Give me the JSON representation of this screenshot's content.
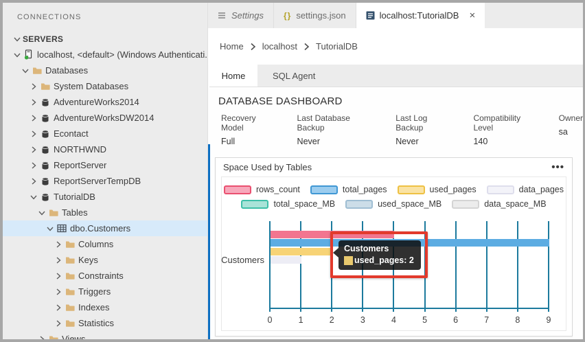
{
  "sidebar": {
    "title": "CONNECTIONS",
    "tree": [
      {
        "label": "SERVERS",
        "level": 0,
        "twistie": "down",
        "icon": null,
        "header": true
      },
      {
        "label": "localhost, <default> (Windows Authenticati...",
        "level": 0,
        "twistie": "down",
        "icon": "server"
      },
      {
        "label": "Databases",
        "level": 1,
        "twistie": "down",
        "icon": "folder"
      },
      {
        "label": "System Databases",
        "level": 2,
        "twistie": "right",
        "icon": "folder"
      },
      {
        "label": "AdventureWorks2014",
        "level": 2,
        "twistie": "right",
        "icon": "database"
      },
      {
        "label": "AdventureWorksDW2014",
        "level": 2,
        "twistie": "right",
        "icon": "database"
      },
      {
        "label": "Econtact",
        "level": 2,
        "twistie": "right",
        "icon": "database"
      },
      {
        "label": "NORTHWND",
        "level": 2,
        "twistie": "right",
        "icon": "database"
      },
      {
        "label": "ReportServer",
        "level": 2,
        "twistie": "right",
        "icon": "database"
      },
      {
        "label": "ReportServerTempDB",
        "level": 2,
        "twistie": "right",
        "icon": "database"
      },
      {
        "label": "TutorialDB",
        "level": 2,
        "twistie": "down",
        "icon": "database"
      },
      {
        "label": "Tables",
        "level": 3,
        "twistie": "down",
        "icon": "folder"
      },
      {
        "label": "dbo.Customers",
        "level": 4,
        "twistie": "down",
        "icon": "table",
        "selected": true
      },
      {
        "label": "Columns",
        "level": 5,
        "twistie": "right",
        "icon": "folder"
      },
      {
        "label": "Keys",
        "level": 5,
        "twistie": "right",
        "icon": "folder"
      },
      {
        "label": "Constraints",
        "level": 5,
        "twistie": "right",
        "icon": "folder"
      },
      {
        "label": "Triggers",
        "level": 5,
        "twistie": "right",
        "icon": "folder"
      },
      {
        "label": "Indexes",
        "level": 5,
        "twistie": "right",
        "icon": "folder"
      },
      {
        "label": "Statistics",
        "level": 5,
        "twistie": "right",
        "icon": "folder"
      },
      {
        "label": "Views",
        "level": 3,
        "twistie": "right",
        "icon": "folder"
      }
    ]
  },
  "editor_tabs": [
    {
      "label": "Settings",
      "icon": "settings-editor-icon",
      "italic": true
    },
    {
      "label": "settings.json",
      "icon": "json-icon",
      "json_glyph": "{}"
    },
    {
      "label": "localhost:TutorialDB",
      "icon": "dashboard-icon",
      "active": true,
      "close": "×"
    }
  ],
  "breadcrumb": {
    "items": [
      "Home",
      "localhost",
      "TutorialDB"
    ]
  },
  "dashboard": {
    "tabs": [
      {
        "label": "Home",
        "active": true
      },
      {
        "label": "SQL Agent",
        "active": false
      }
    ],
    "title": "DATABASE DASHBOARD",
    "properties": [
      {
        "label": "Recovery Model",
        "value": "Full"
      },
      {
        "label": "Last Database Backup",
        "value": "Never"
      },
      {
        "label": "Last Log Backup",
        "value": "Never"
      },
      {
        "label": "Compatibility Level",
        "value": "140"
      },
      {
        "label": "Owner",
        "value": "sa"
      }
    ]
  },
  "widget": {
    "title": "Space Used by Tables",
    "menu_glyph": "•••"
  },
  "chart_data": {
    "type": "bar",
    "orientation": "horizontal",
    "title": "Space Used by Tables",
    "categories": [
      "Customers"
    ],
    "series": [
      {
        "name": "rows_count",
        "values": [
          4
        ],
        "bar_color": "#F2758F",
        "legend_fill": "#F7A8BB",
        "legend_border": "#EA5070"
      },
      {
        "name": "total_pages",
        "values": [
          9
        ],
        "bar_color": "#5CACE2",
        "legend_fill": "#9CCDEF",
        "legend_border": "#3F97D4"
      },
      {
        "name": "used_pages",
        "values": [
          2
        ],
        "bar_color": "#F7D376",
        "legend_fill": "#FAE3A4",
        "legend_border": "#EEC143"
      },
      {
        "name": "data_pages",
        "values": [
          1
        ],
        "bar_color": "#EDEDF5",
        "legend_fill": "#F3F3F9",
        "legend_border": "#DEDEEC"
      },
      {
        "name": "total_space_MB",
        "values": [
          0
        ],
        "bar_color": "#63CBB8",
        "legend_fill": "#A9E3D8",
        "legend_border": "#3DBFA8"
      },
      {
        "name": "used_space_MB",
        "values": [
          0
        ],
        "bar_color": "#AEC9DB",
        "legend_fill": "#CCDDE8",
        "legend_border": "#9FBED3"
      },
      {
        "name": "data_space_MB",
        "values": [
          0
        ],
        "bar_color": "#E2E2E2",
        "legend_fill": "#ECECEC",
        "legend_border": "#D4D4D4"
      }
    ],
    "legend_rows": [
      [
        "rows_count",
        "total_pages",
        "used_pages",
        "data_pages"
      ],
      [
        "total_space_MB",
        "used_space_MB",
        "data_space_MB"
      ]
    ],
    "xlim": [
      0,
      9
    ],
    "xticks": [
      "0",
      "1",
      "2",
      "3",
      "4",
      "5",
      "6",
      "7",
      "8",
      "9"
    ],
    "grid": true,
    "legend_position": "top",
    "axis_color": "#1c7a9d"
  },
  "tooltip": {
    "title": "Customers",
    "line": "used_pages: 2"
  },
  "colors": {
    "focus_line": "#0d6fc2",
    "selection_bg": "#d7eafa",
    "annotation_red": "#e23a2c"
  }
}
